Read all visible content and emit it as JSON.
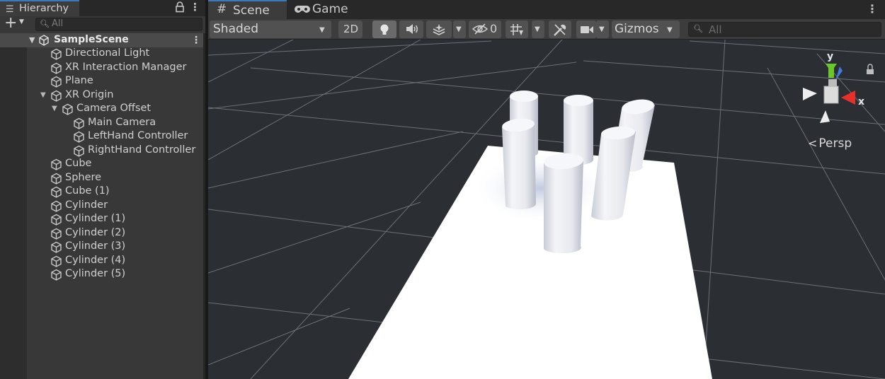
{
  "hierarchy": {
    "tab_label": "Hierarchy",
    "tab_icon": "list-icon",
    "search_placeholder": "All",
    "scene_name": "SampleScene",
    "items": [
      {
        "label": "Directional Light",
        "depth": 0,
        "expanded": null
      },
      {
        "label": "XR Interaction Manager",
        "depth": 0,
        "expanded": null
      },
      {
        "label": "Plane",
        "depth": 0,
        "expanded": null
      },
      {
        "label": "XR Origin",
        "depth": 0,
        "expanded": true
      },
      {
        "label": "Camera Offset",
        "depth": 1,
        "expanded": true
      },
      {
        "label": "Main Camera",
        "depth": 2,
        "expanded": null
      },
      {
        "label": "LeftHand Controller",
        "depth": 2,
        "expanded": null
      },
      {
        "label": "RightHand Controller",
        "depth": 2,
        "expanded": null
      },
      {
        "label": "Cube",
        "depth": 0,
        "expanded": null
      },
      {
        "label": "Sphere",
        "depth": 0,
        "expanded": null
      },
      {
        "label": "Cube (1)",
        "depth": 0,
        "expanded": null
      },
      {
        "label": "Cylinder",
        "depth": 0,
        "expanded": null
      },
      {
        "label": "Cylinder (1)",
        "depth": 0,
        "expanded": null
      },
      {
        "label": "Cylinder (2)",
        "depth": 0,
        "expanded": null
      },
      {
        "label": "Cylinder (3)",
        "depth": 0,
        "expanded": null
      },
      {
        "label": "Cylinder (4)",
        "depth": 0,
        "expanded": null
      },
      {
        "label": "Cylinder (5)",
        "depth": 0,
        "expanded": null
      }
    ]
  },
  "scene_view": {
    "tabs": [
      {
        "label": "Scene",
        "icon": "grid-icon",
        "active": true
      },
      {
        "label": "Game",
        "icon": "gamepad-icon",
        "active": false
      }
    ],
    "toolbar": {
      "draw_mode": "Shaded",
      "mode_2d": "2D",
      "hidden_count": "0",
      "gizmos": "Gizmos",
      "search_placeholder": "All"
    },
    "gizmo": {
      "y_label": "y",
      "x_label": "x",
      "projection": "Persp"
    }
  },
  "colors": {
    "accent": "#3a79bb",
    "panel": "#383838",
    "viewport_bg": "#2b2e33",
    "gizmo_x": "#e8302a",
    "gizmo_y": "#6ac72c",
    "gizmo_z": "#3f7de0"
  }
}
